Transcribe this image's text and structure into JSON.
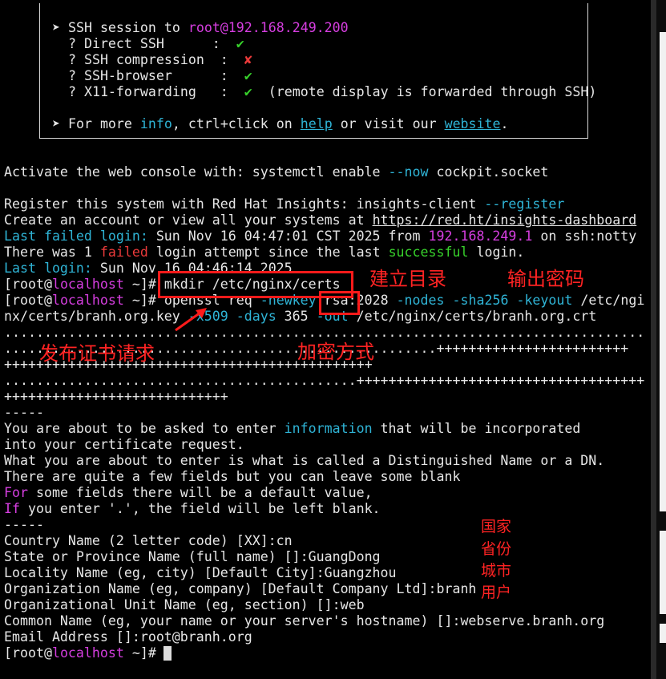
{
  "banner": {
    "session_prefix": "➤ SSH session to ",
    "session_target": "root@192.168.249.200",
    "direct_ssh_label": "  ? Direct SSH      :  ",
    "direct_ssh_status": "✔",
    "compression_label": "  ? SSH compression  :  ",
    "compression_status": "✘",
    "browser_label": "  ? SSH-browser      :  ",
    "browser_status": "✔",
    "x11_label": "  ? X11-forwarding   :  ",
    "x11_status": "✔",
    "x11_note": "  (remote display is forwarded through SSH)",
    "more_prefix": "➤ For more ",
    "more_info": "info",
    "more_mid": ", ctrl+click on ",
    "more_help": "help",
    "more_mid2": " or visit our ",
    "more_website": "website",
    "more_end": "."
  },
  "console": {
    "activate_prefix": "Activate the web console with: systemctl enable ",
    "activate_flag": "--now",
    "activate_suffix": " cockpit.socket",
    "register_prefix": "Register this system with Red Hat Insights: insights-client ",
    "register_flag": "--register",
    "account_prefix": "Create an account or view all your systems at ",
    "account_url": "https://red.ht/insights-dashboard",
    "failed_label": "Last failed login:",
    "failed_text": " Sun Nov 16 04:47:01 CST 2025 from ",
    "failed_ip": "192.168.249.1",
    "failed_suffix": " on ssh:notty",
    "attempt_prefix": "There was 1 ",
    "attempt_failed": "failed",
    "attempt_mid": " login attempt since the last ",
    "attempt_success": "successful",
    "attempt_suffix": " login.",
    "last_label": "Last login:",
    "last_text": " Sun Nov 16 04:46:14 2025"
  },
  "prompt": {
    "open": "[root@",
    "host": "localhost",
    "close": " ~]# "
  },
  "commands": {
    "mkdir": "mkdir /etc/nginx/certs",
    "openssl_1": "openssl req ",
    "openssl_newkey": "-newkey",
    "openssl_2": " rsa:2028 ",
    "openssl_nodes": "-nodes",
    "openssl_3": " ",
    "openssl_sha": "-sha256",
    "openssl_4": " ",
    "openssl_keyout": "-keyout",
    "openssl_5": " /etc/ngi",
    "openssl_wrap_1": "nx/certs/branh.org.key ",
    "openssl_x509": "-x509",
    "openssl_wrap_2": " ",
    "openssl_days": "-days",
    "openssl_wrap_3": " 365 ",
    "openssl_out": "-out",
    "openssl_wrap_4": " /etc/nginx/certs/branh.org.crt"
  },
  "progress": {
    "row1": "................................................................................",
    "row2": "......................................................++++++++++++++++++++++++",
    "row3": "++++++++++++++++++++++++++++++++++++++++++++++",
    "row4": "............................................++++++++++++++++++++++++++++++++++++",
    "row5": "++++++++++++++++++++++++++++"
  },
  "request": {
    "sep1": "-----",
    "about_prefix": "You are about to be asked to enter ",
    "about_info": "information",
    "about_suffix": " that will be incorporated",
    "into": "into your certificate request.",
    "what": "What you are about to enter is what is called a Distinguished Name or a DN.",
    "few": "There are quite a few fields but you can leave some blank",
    "for_kw": "For",
    "for_rest": " some fields there will be a default value,",
    "if_kw": "If",
    "if_rest": " you enter '.', the field will be left blank.",
    "sep2": "-----",
    "country": "Country Name (2 letter code) [XX]:cn",
    "state": "State or Province Name (full name) []:GuangDong",
    "locality": "Locality Name (eg, city) [Default City]:Guangzhou",
    "org": "Organization Name (eg, company) [Default Company Ltd]:branh",
    "unit": "Organizational Unit Name (eg, section) []:web",
    "common": "Common Name (eg, your name or your server's hostname) []:webserve.branh.org",
    "email": "Email Address []:root@branh.org"
  },
  "annotations": {
    "mkdir_note": "建立目录",
    "output_key_note": "输出密码",
    "request_note": "发布证书请求",
    "encryption_note": "加密方式",
    "country_note": "国家",
    "province_note": "省份",
    "city_note": "城市",
    "user_note": "用户"
  },
  "colors": {
    "accent_red": "#ff2323",
    "prompt_magenta": "#d63ee0",
    "option_cyan": "#2fb4d6",
    "ok_green": "#37d02b"
  }
}
